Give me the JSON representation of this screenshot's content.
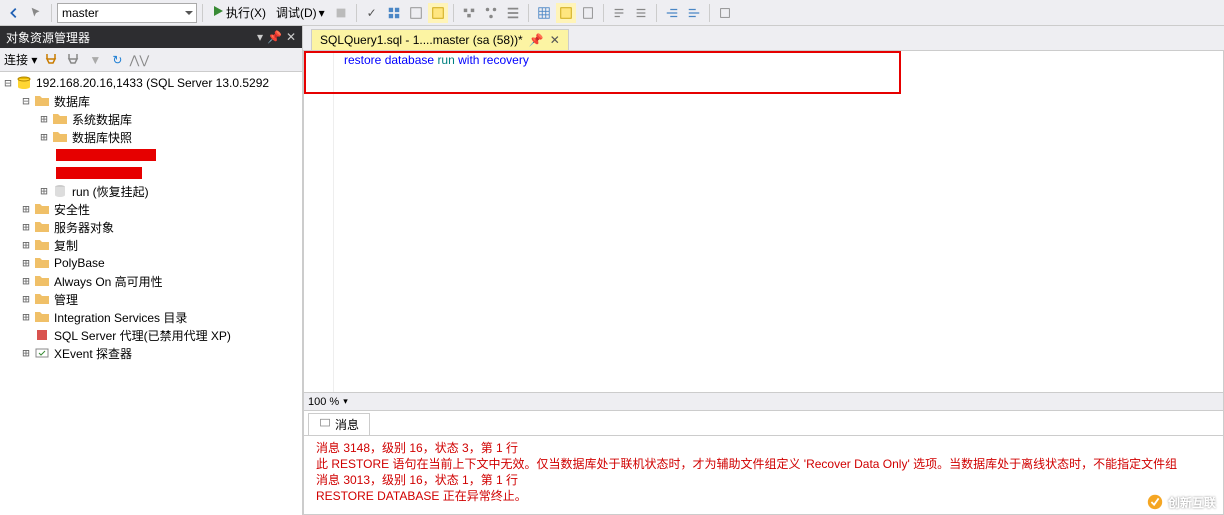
{
  "toolbar": {
    "db_selector": "master",
    "execute_label": "执行(X)",
    "debug_label": "调试(D)"
  },
  "object_explorer": {
    "title": "对象资源管理器",
    "connect_label": "连接 ▾",
    "server": "192.168.20.16,1433 (SQL Server 13.0.5292",
    "nodes": {
      "databases": "数据库",
      "sys_db": "系统数据库",
      "db_snapshot": "数据库快照",
      "run_db": "run (恢复挂起)",
      "security": "安全性",
      "server_objects": "服务器对象",
      "replication": "复制",
      "polybase": "PolyBase",
      "always_on": "Always On 高可用性",
      "management": "管理",
      "integration": "Integration Services 目录",
      "sql_agent": "SQL Server 代理(已禁用代理 XP)",
      "xevent": "XEvent 探查器"
    }
  },
  "tab": {
    "title": "SQLQuery1.sql - 1....master (sa (58))*"
  },
  "sql": {
    "kw1": "restore",
    "kw2": "database",
    "ident": "run",
    "kw3": "with",
    "kw4": "recovery"
  },
  "zoom": "100 %",
  "messages": {
    "tab_label": "消息",
    "line1": "消息 3148，级别 16，状态 3，第 1 行",
    "line2": "此 RESTORE 语句在当前上下文中无效。仅当数据库处于联机状态时，才为辅助文件组定义 'Recover Data Only' 选项。当数据库处于离线状态时，不能指定文件组",
    "line3": "消息 3013，级别 16，状态 1，第 1 行",
    "line4": "RESTORE DATABASE 正在异常终止。"
  },
  "watermark": "创新互联"
}
